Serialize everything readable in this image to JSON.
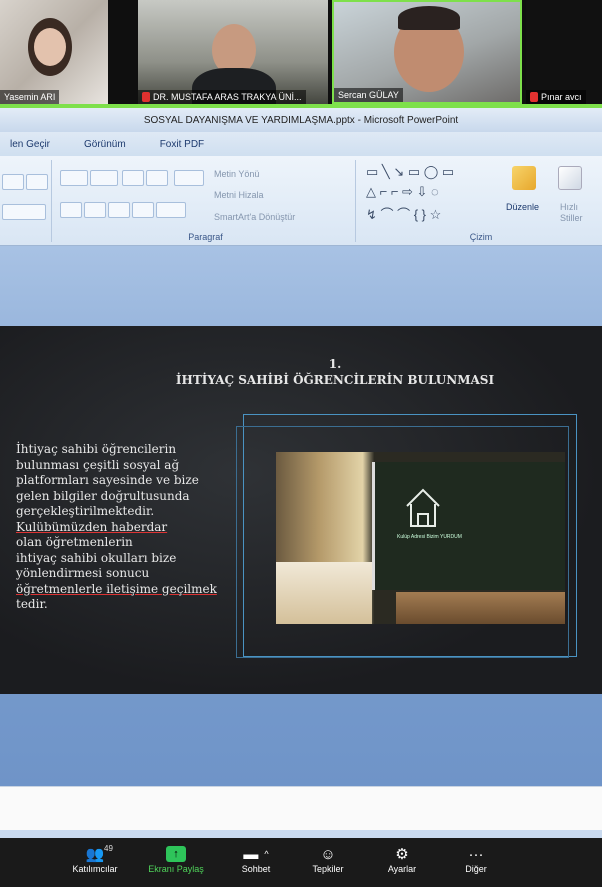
{
  "participants": [
    {
      "name": "Yasemin ARI"
    },
    {
      "name": "DR. MUSTAFA ARAS TRAKYA ÜNİ..."
    },
    {
      "name": "Sercan GÜLAY"
    },
    {
      "name": "Pınar avcı"
    }
  ],
  "powerpoint": {
    "window_title": "SOSYAL DAYANIŞMA VE YARDIMLAŞMA.pptx - Microsoft PowerPoint",
    "tabs": [
      "len Geçir",
      "Görünüm",
      "Foxit PDF"
    ],
    "ribbon": {
      "paragraph_group_label": "Paragraf",
      "metin_yonu": "Metin Yönü",
      "metni_hizala": "Metni Hizala",
      "smartart": "SmartArt'a Dönüştür",
      "drawing_group_label": "Çizim",
      "duzenle": "Düzenle",
      "hizli_stiller": "Hızlı Stiller"
    }
  },
  "slide": {
    "number": "1.",
    "title": "İHTİYAÇ SAHİBİ ÖĞRENCİLERİN BULUNMASI",
    "body_lines": [
      "İhtiyaç sahibi öğrencilerin",
      "bulunması çeşitli sosyal ağ",
      "platformları sayesinde ve bize",
      "gelen bilgiler doğrultusunda",
      "gerçekleştirilmektedir.",
      "Kulübümüzden haberdar",
      "olan öğretmenlerin",
      "ihtiyaç sahibi okulları bize",
      "yönlendirmesi sonucu",
      "öğretmenlerle iletişime geçilmek",
      "tedir."
    ],
    "photo_board_text": "Kulüp Adresi Bizim YURDUM"
  },
  "toolbar": {
    "participants_label": "Katılımcılar",
    "participants_count": "49",
    "share_label": "Ekranı Paylaş",
    "chat_label": "Sohbet",
    "reactions_label": "Tepkiler",
    "settings_label": "Ayarlar",
    "more_label": "Diğer"
  }
}
